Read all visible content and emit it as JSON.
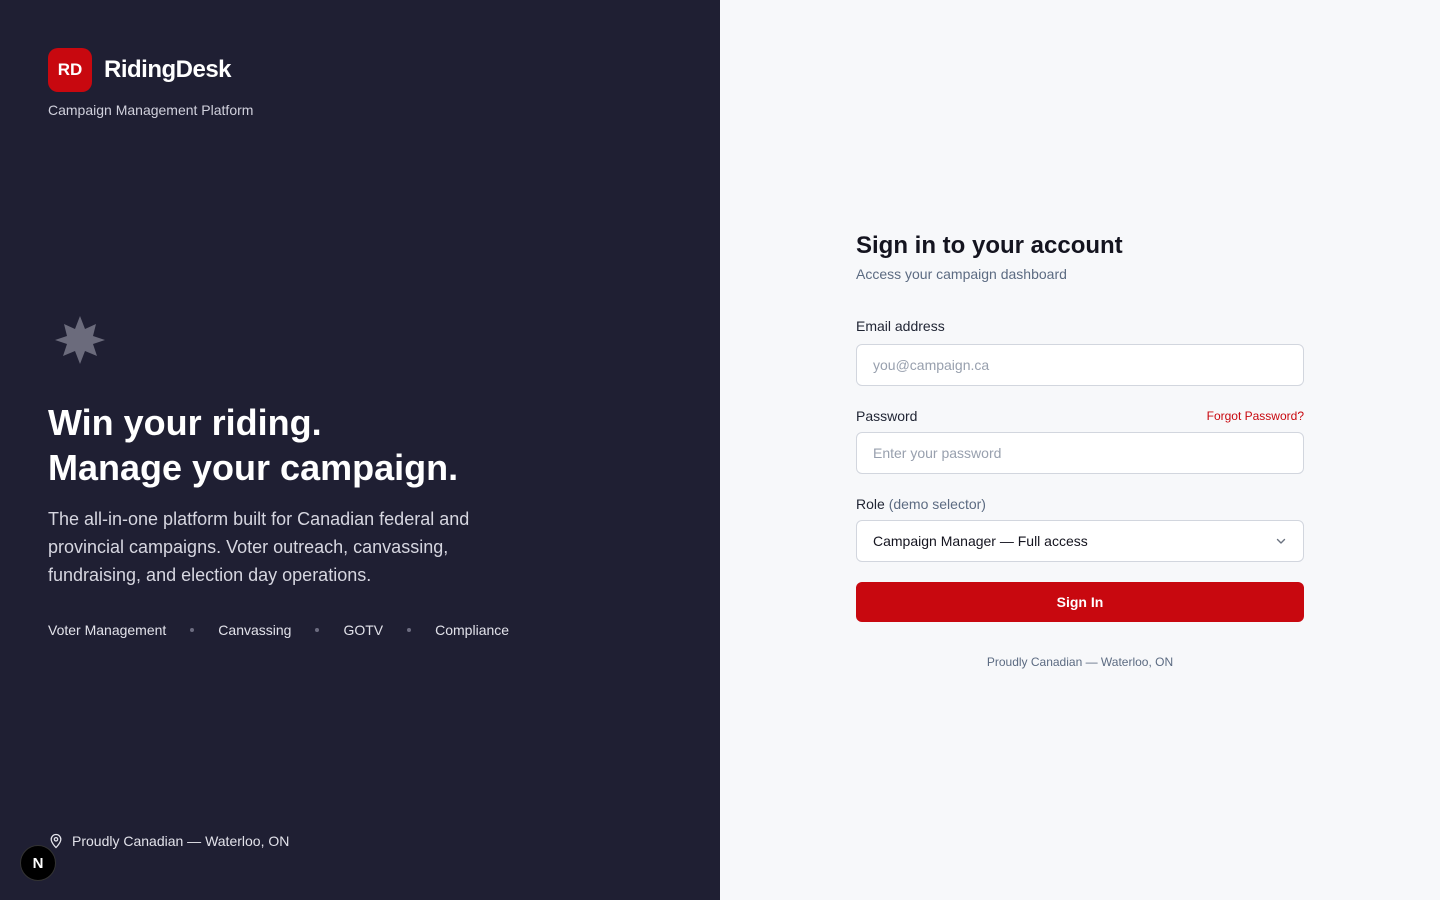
{
  "brand": {
    "logo_text": "RD",
    "name": "RidingDesk",
    "tagline": "Campaign Management Platform",
    "accent_color": "#c8080f"
  },
  "hero": {
    "icon": "maple-leaf-icon",
    "headline_line1": "Win your riding.",
    "headline_line2": "Manage your campaign.",
    "description": "The all-in-one platform built for Canadian federal and provincial campaigns. Voter outreach, canvassing, fundraising, and election day operations.",
    "features": [
      "Voter Management",
      "Canvassing",
      "GOTV",
      "Compliance"
    ]
  },
  "left_footer": {
    "icon": "location-pin-icon",
    "text": "Proudly Canadian — Waterloo, ON"
  },
  "dev_badge": {
    "text": "N"
  },
  "signin": {
    "title": "Sign in to your account",
    "subtitle": "Access your campaign dashboard",
    "email_label": "Email address",
    "email_placeholder": "you@campaign.ca",
    "email_value": "",
    "password_label": "Password",
    "forgot_label": "Forgot Password?",
    "password_placeholder": "Enter your password",
    "password_value": "",
    "role_label": "Role",
    "role_hint": "(demo selector)",
    "role_selected": "Campaign Manager — Full access",
    "submit_label": "Sign In",
    "footer": "Proudly Canadian — Waterloo, ON"
  }
}
